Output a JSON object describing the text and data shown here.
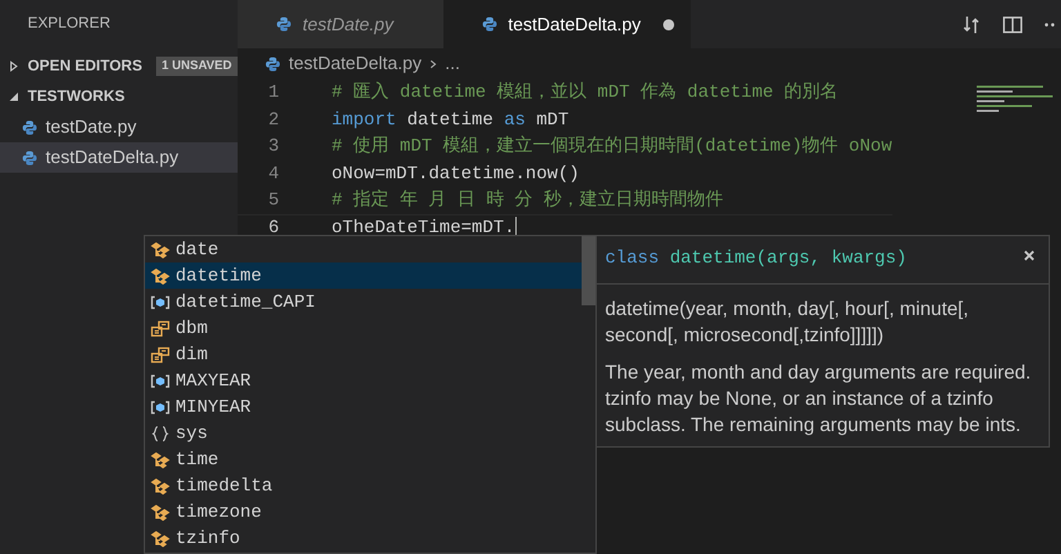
{
  "sidebar": {
    "title": "EXPLORER",
    "sections": [
      {
        "label": "OPEN EDITORS",
        "expanded": false,
        "badge": "1 UNSAVED"
      },
      {
        "label": "TESTWORKS",
        "expanded": true
      }
    ],
    "files": [
      {
        "name": "testDate.py",
        "selected": false
      },
      {
        "name": "testDateDelta.py",
        "selected": true
      }
    ]
  },
  "tabs": [
    {
      "label": "testDate.py",
      "selected": false,
      "preview": true,
      "dirty": false
    },
    {
      "label": "testDateDelta.py",
      "selected": true,
      "preview": false,
      "dirty": true
    }
  ],
  "breadcrumb": {
    "file": "testDateDelta.py",
    "rest": "..."
  },
  "code": [
    {
      "number": "1",
      "current": false,
      "tokens": [
        {
          "kind": "comment",
          "text": "# 匯入 datetime 模組，並以 mDT 作為 datetime 的別名"
        }
      ]
    },
    {
      "number": "2",
      "current": false,
      "tokens": [
        {
          "kind": "keyword",
          "text": "import"
        },
        {
          "kind": "plain",
          "text": " datetime "
        },
        {
          "kind": "keyword",
          "text": "as"
        },
        {
          "kind": "plain",
          "text": " mDT"
        }
      ]
    },
    {
      "number": "3",
      "current": false,
      "tokens": [
        {
          "kind": "comment",
          "text": "# 使用 mDT 模組，建立一個現在的日期時間(datetime)物件 oNow"
        }
      ]
    },
    {
      "number": "4",
      "current": false,
      "tokens": [
        {
          "kind": "plain",
          "text": "oNow=mDT.datetime.now()"
        }
      ]
    },
    {
      "number": "5",
      "current": false,
      "tokens": [
        {
          "kind": "comment",
          "text": "# 指定 年 月 日 時 分 秒，建立日期時間物件"
        }
      ]
    },
    {
      "number": "6",
      "current": true,
      "tokens": [
        {
          "kind": "plain",
          "text": "oTheDateTime=mDT."
        }
      ]
    }
  ],
  "suggestions": [
    {
      "label": "date",
      "kind": "class",
      "selected": false
    },
    {
      "label": "datetime",
      "kind": "class",
      "selected": true
    },
    {
      "label": "datetime_CAPI",
      "kind": "variable",
      "selected": false
    },
    {
      "label": "dbm",
      "kind": "enum",
      "selected": false
    },
    {
      "label": "dim",
      "kind": "enum",
      "selected": false
    },
    {
      "label": "MAXYEAR",
      "kind": "variable",
      "selected": false
    },
    {
      "label": "MINYEAR",
      "kind": "variable",
      "selected": false
    },
    {
      "label": "sys",
      "kind": "module",
      "selected": false
    },
    {
      "label": "time",
      "kind": "class",
      "selected": false
    },
    {
      "label": "timedelta",
      "kind": "class",
      "selected": false
    },
    {
      "label": "timezone",
      "kind": "class",
      "selected": false
    },
    {
      "label": "tzinfo",
      "kind": "class",
      "selected": false
    }
  ],
  "details": {
    "signature": [
      {
        "kind": "keyword",
        "text": "class"
      },
      {
        "kind": "name",
        "text": " datetime(args, kwargs)"
      }
    ],
    "paragraphs": [
      "datetime(year, month, day[, hour[, minute[, second[, microsecond[,tzinfo]]]]])",
      "The year, month and day arguments are required. tzinfo may be None, or an instance of a tzinfo subclass. The remaining arguments may be ints."
    ]
  }
}
